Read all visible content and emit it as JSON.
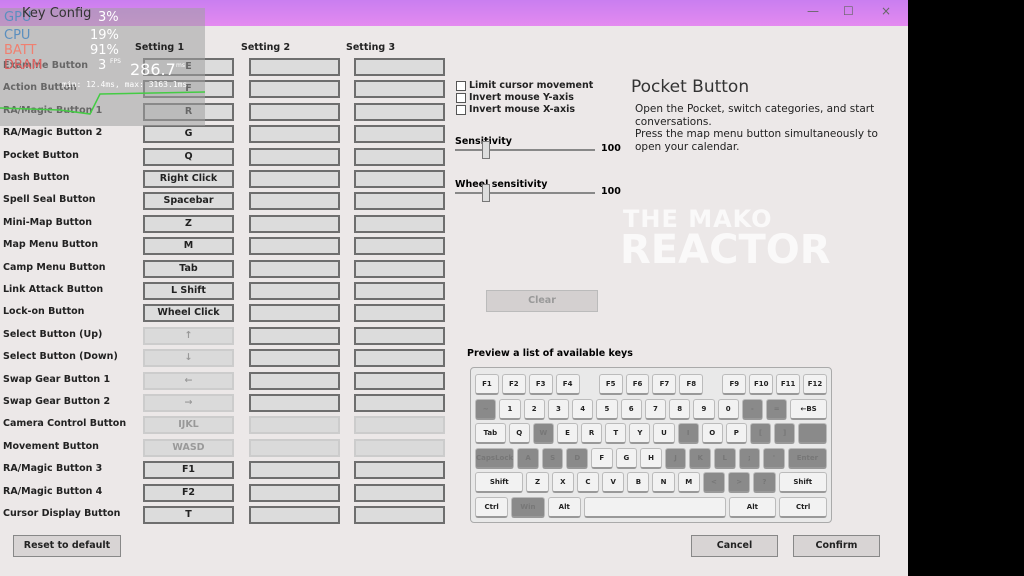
{
  "window": {
    "title": "Key Config",
    "minimize": "—",
    "maximize": "☐",
    "close": "×"
  },
  "columns": [
    "Setting 1",
    "Setting 2",
    "Setting 3"
  ],
  "rows": [
    {
      "label": "Examine Button",
      "s1": "E",
      "d1": false,
      "d23": false
    },
    {
      "label": "Action Button",
      "s1": "F",
      "d1": false,
      "d23": false
    },
    {
      "label": "RA/Magic Button 1",
      "s1": "R",
      "d1": false,
      "d23": false
    },
    {
      "label": "RA/Magic Button 2",
      "s1": "G",
      "d1": false,
      "d23": false
    },
    {
      "label": "Pocket Button",
      "s1": "Q",
      "d1": false,
      "d23": false
    },
    {
      "label": "Dash Button",
      "s1": "Right Click",
      "d1": false,
      "d23": false
    },
    {
      "label": "Spell Seal Button",
      "s1": "Spacebar",
      "d1": false,
      "d23": false
    },
    {
      "label": "Mini-Map Button",
      "s1": "Z",
      "d1": false,
      "d23": false
    },
    {
      "label": "Map Menu Button",
      "s1": "M",
      "d1": false,
      "d23": false
    },
    {
      "label": "Camp Menu Button",
      "s1": "Tab",
      "d1": false,
      "d23": false
    },
    {
      "label": "Link Attack Button",
      "s1": "L Shift",
      "d1": false,
      "d23": false
    },
    {
      "label": "Lock-on Button",
      "s1": "Wheel Click",
      "d1": false,
      "d23": false
    },
    {
      "label": "Select Button (Up)",
      "s1": "↑",
      "d1": true,
      "d23": false
    },
    {
      "label": "Select Button (Down)",
      "s1": "↓",
      "d1": true,
      "d23": false
    },
    {
      "label": "Swap Gear Button 1",
      "s1": "←",
      "d1": true,
      "d23": false
    },
    {
      "label": "Swap Gear Button 2",
      "s1": "→",
      "d1": true,
      "d23": false
    },
    {
      "label": "Camera Control Button",
      "s1": "IJKL",
      "d1": true,
      "d23": true
    },
    {
      "label": "Movement Button",
      "s1": "WASD",
      "d1": true,
      "d23": true
    },
    {
      "label": "RA/Magic Button 3",
      "s1": "F1",
      "d1": false,
      "d23": false
    },
    {
      "label": "RA/Magic Button 4",
      "s1": "F2",
      "d1": false,
      "d23": false
    },
    {
      "label": "Cursor Display Button",
      "s1": "T",
      "d1": false,
      "d23": false
    }
  ],
  "options": {
    "limit_cursor": "Limit cursor movement",
    "invert_y": "Invert mouse Y-axis",
    "invert_x": "Invert mouse X-axis",
    "sensitivity_label": "Sensitivity",
    "sensitivity_value": "100",
    "wheel_label": "Wheel sensitivity",
    "wheel_value": "100"
  },
  "info": {
    "title": "Pocket Button",
    "desc1": "Open the Pocket, switch categories, and start conversations.",
    "desc2": "Press the map menu button simultaneously to open your calendar."
  },
  "clear_label": "Clear",
  "preview_label": "Preview a list of available keys",
  "keyboard": [
    [
      [
        "F1",
        1,
        0
      ],
      [
        "F2",
        1,
        0
      ],
      [
        "F3",
        1,
        0
      ],
      [
        "F4",
        1,
        0
      ],
      [
        "",
        0.6,
        -1
      ],
      [
        "F5",
        1,
        0
      ],
      [
        "F6",
        1,
        0
      ],
      [
        "F7",
        1,
        0
      ],
      [
        "F8",
        1,
        0
      ],
      [
        "",
        0.6,
        -1
      ],
      [
        "F9",
        1,
        0
      ],
      [
        "F10",
        1,
        0
      ],
      [
        "F11",
        1,
        0
      ],
      [
        "F12",
        1,
        0
      ]
    ],
    [
      [
        "~",
        1,
        1
      ],
      [
        "1",
        1,
        0
      ],
      [
        "2",
        1,
        0
      ],
      [
        "3",
        1,
        0
      ],
      [
        "4",
        1,
        0
      ],
      [
        "5",
        1,
        0
      ],
      [
        "6",
        1,
        0
      ],
      [
        "7",
        1,
        0
      ],
      [
        "8",
        1,
        0
      ],
      [
        "9",
        1,
        0
      ],
      [
        "0",
        1,
        0
      ],
      [
        "-",
        1,
        1
      ],
      [
        "=",
        1,
        1
      ],
      [
        "←BS",
        1.8,
        0
      ]
    ],
    [
      [
        "Tab",
        1.5,
        0
      ],
      [
        "Q",
        1,
        0
      ],
      [
        "W",
        1,
        1
      ],
      [
        "E",
        1,
        0
      ],
      [
        "R",
        1,
        0
      ],
      [
        "T",
        1,
        0
      ],
      [
        "Y",
        1,
        0
      ],
      [
        "U",
        1,
        0
      ],
      [
        "I",
        1,
        1
      ],
      [
        "O",
        1,
        0
      ],
      [
        "P",
        1,
        0
      ],
      [
        "[",
        1,
        1
      ],
      [
        "]",
        1,
        1
      ],
      [
        "",
        1.4,
        1
      ]
    ],
    [
      [
        "CapsLock",
        1.9,
        1
      ],
      [
        "A",
        1,
        1
      ],
      [
        "S",
        1,
        1
      ],
      [
        "D",
        1,
        1
      ],
      [
        "F",
        1,
        0
      ],
      [
        "G",
        1,
        0
      ],
      [
        "H",
        1,
        0
      ],
      [
        "J",
        1,
        1
      ],
      [
        "K",
        1,
        1
      ],
      [
        "L",
        1,
        1
      ],
      [
        ";",
        1,
        1
      ],
      [
        "'",
        1,
        1
      ],
      [
        "Enter",
        1.9,
        1
      ]
    ],
    [
      [
        "Shift",
        2.3,
        0
      ],
      [
        "Z",
        1,
        0
      ],
      [
        "X",
        1,
        0
      ],
      [
        "C",
        1,
        0
      ],
      [
        "V",
        1,
        0
      ],
      [
        "B",
        1,
        0
      ],
      [
        "N",
        1,
        0
      ],
      [
        "M",
        1,
        0
      ],
      [
        "<",
        1,
        1
      ],
      [
        ">",
        1,
        1
      ],
      [
        "?",
        1,
        1
      ],
      [
        "Shift",
        2.3,
        0
      ]
    ],
    [
      [
        "Ctrl",
        1.3,
        0
      ],
      [
        "Win",
        1.3,
        1
      ],
      [
        "Alt",
        1.3,
        0
      ],
      [
        "",
        5.8,
        0
      ],
      [
        "Alt",
        1.9,
        0
      ],
      [
        "Ctrl",
        1.9,
        0
      ]
    ]
  ],
  "buttons": {
    "reset": "Reset to default",
    "cancel": "Cancel",
    "confirm": "Confirm"
  },
  "hud": {
    "gpu_label": "GPU",
    "gpu": "3%",
    "cpu_label": "CPU",
    "cpu": "19%",
    "batt_label": "BATT",
    "batt": "91%",
    "dram_label": "DRAM",
    "fps": "3",
    "fps_unit": "FPS",
    "frametime": "286.7",
    "frametime_unit": "ms",
    "minmax": "min: 12.4ms, max: 3163.1ms"
  },
  "watermark": {
    "line1": "THE MAKO",
    "line2": "REACTOR"
  },
  "colors": {
    "titlebar": "#d884f0",
    "hud_gpu": "#5b8fbf",
    "hud_batt": "#f08070"
  }
}
